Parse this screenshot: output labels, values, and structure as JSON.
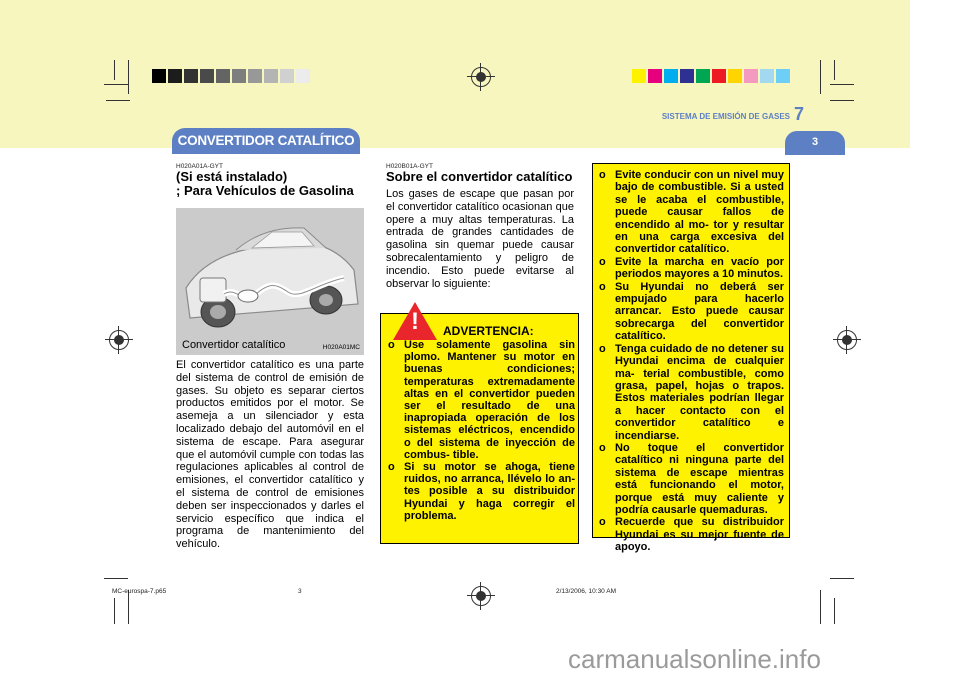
{
  "header": {
    "running_head": "SISTEMA DE EMISIÓN DE GASES",
    "chapter_number": "7",
    "page_number": "3",
    "section_title": "CONVERTIDOR CATALÍTICO",
    "band_color": "#f8f6bf",
    "accent_color": "#5d80c4",
    "grey_swatches": [
      "#000000",
      "#1c1c1c",
      "#333333",
      "#4a4a4a",
      "#646464",
      "#7e7e7e",
      "#989898",
      "#b4b4b4",
      "#d0d0d0",
      "#ececec"
    ],
    "color_swatches": [
      "#fff200",
      "#e6007e",
      "#00aeef",
      "#2e3192",
      "#00a651",
      "#ed1c24",
      "#ffd400",
      "#f49ac1",
      "#a3d9f0",
      "#6dcff6"
    ]
  },
  "left": {
    "code": "H020A01A-GYT",
    "heading_line1": "(Si está instalado)",
    "heading_line2": "; Para Vehículos de Gasolina",
    "figure_caption": "Convertidor catalítico",
    "figure_id": "H020A01MC",
    "body": "El convertidor catalítico es una parte del sistema de control de emisión de gases. Su objeto es separar ciertos productos emitidos por el motor. Se asemeja a un silenciador y esta localizado debajo del automóvil en el sistema de escape. Para asegurar que el automóvil cumple con todas las regulaciones aplicables al control de emisiones, el convertidor catalítico y el sistema de control de emisiones deben ser inspeccionados y darles el servicio específico que indica el programa de mantenimiento del vehículo."
  },
  "middle": {
    "code": "H020B01A-GYT",
    "heading": "Sobre el convertidor catalítico",
    "body": "Los gases de escape que pasan por el convertidor catalítico ocasionan que opere a muy altas temperaturas. La entrada de grandes cantidades de gasolina sin quemar puede causar sobrecalentamiento y peligro de incendio. Esto puede evitarse al observar lo siguiente:"
  },
  "warning": {
    "icon": "!",
    "title": "ADVERTENCIA:",
    "items": [
      "Use solamente gasolina sin plomo. Mantener su motor en buenas condiciones; temperaturas extremadamente altas en el convertidor pueden ser el resultado de una inapropiada operación de los sistemas eléctricos, encendido o del sistema de inyección de combus- tible.",
      "Si su motor se ahoga, tiene ruidos, no arranca, llévelo lo an- tes posible a su distribuidor Hyundai y haga corregir el problema."
    ],
    "box_color": "#fff200",
    "icon_color": "#e8262b"
  },
  "right": {
    "items": [
      "Evite conducir con un nivel muy bajo de combustible. Si a usted se le acaba el combustible, puede causar fallos de encendido al mo- tor y resultar en una carga excesiva del convertidor catalítico.",
      "Evite la marcha en vacío por periodos mayores a 10 minutos.",
      "Su Hyundai no deberá ser empujado para hacerlo arrancar. Esto puede causar sobrecarga del convertidor catalítico.",
      "Tenga cuidado de no detener su Hyundai encima de cualquier ma- terial combustible, como grasa, papel, hojas o trapos. Estos materiales podrían llegar a hacer contacto con el convertidor catalítico e incendiarse.",
      "No toque el convertidor catalítico ni ninguna parte del sistema de escape mientras está funcionando el motor, porque está muy caliente y podría causarle quemaduras.",
      "Recuerde que su distribuidor Hyundai es su mejor fuente de apoyo."
    ]
  },
  "bullet_marker": "o",
  "footer": {
    "file": "MC-eurospa-7.p65",
    "page": "3",
    "timestamp": "2/13/2006, 10:30 AM"
  },
  "watermark": "carmanualsonline.info"
}
